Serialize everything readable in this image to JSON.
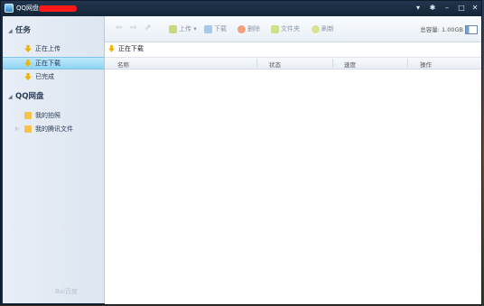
{
  "window": {
    "title": "QQ网盘 -"
  },
  "titlebar": {
    "controls": [
      "▾",
      "✱",
      "–",
      "□",
      "✕"
    ]
  },
  "sidebar": {
    "tasks_heading": "任务",
    "tasks": [
      {
        "label": "正在上传",
        "icon": "download-arrow-icon",
        "selected": false
      },
      {
        "label": "正在下载",
        "icon": "download-arrow-icon",
        "selected": true
      },
      {
        "label": "已完成",
        "icon": "download-arrow-icon",
        "selected": false
      }
    ],
    "netdisk_heading": "QQ网盘",
    "folders": [
      {
        "label": "我的拍照",
        "icon": "folder-icon"
      },
      {
        "label": "我的腾讯文件",
        "icon": "folder-icon"
      }
    ],
    "watermark": "Bai百度"
  },
  "toolbar": {
    "upload": "上传",
    "download": "下载",
    "delete": "删除",
    "new_folder": "文件夹",
    "refresh": "刷新",
    "quota_label": "总容量: 1.00GB"
  },
  "breadcrumb": {
    "label": "正在下载"
  },
  "table": {
    "headers": [
      "名称",
      "状态",
      "速度",
      "操作"
    ],
    "rows": []
  },
  "colors": {
    "titlebar": "#16283d",
    "sidebar": "#e3eaf4",
    "selected": "#9fdaf5",
    "accent": "#f0b400"
  }
}
